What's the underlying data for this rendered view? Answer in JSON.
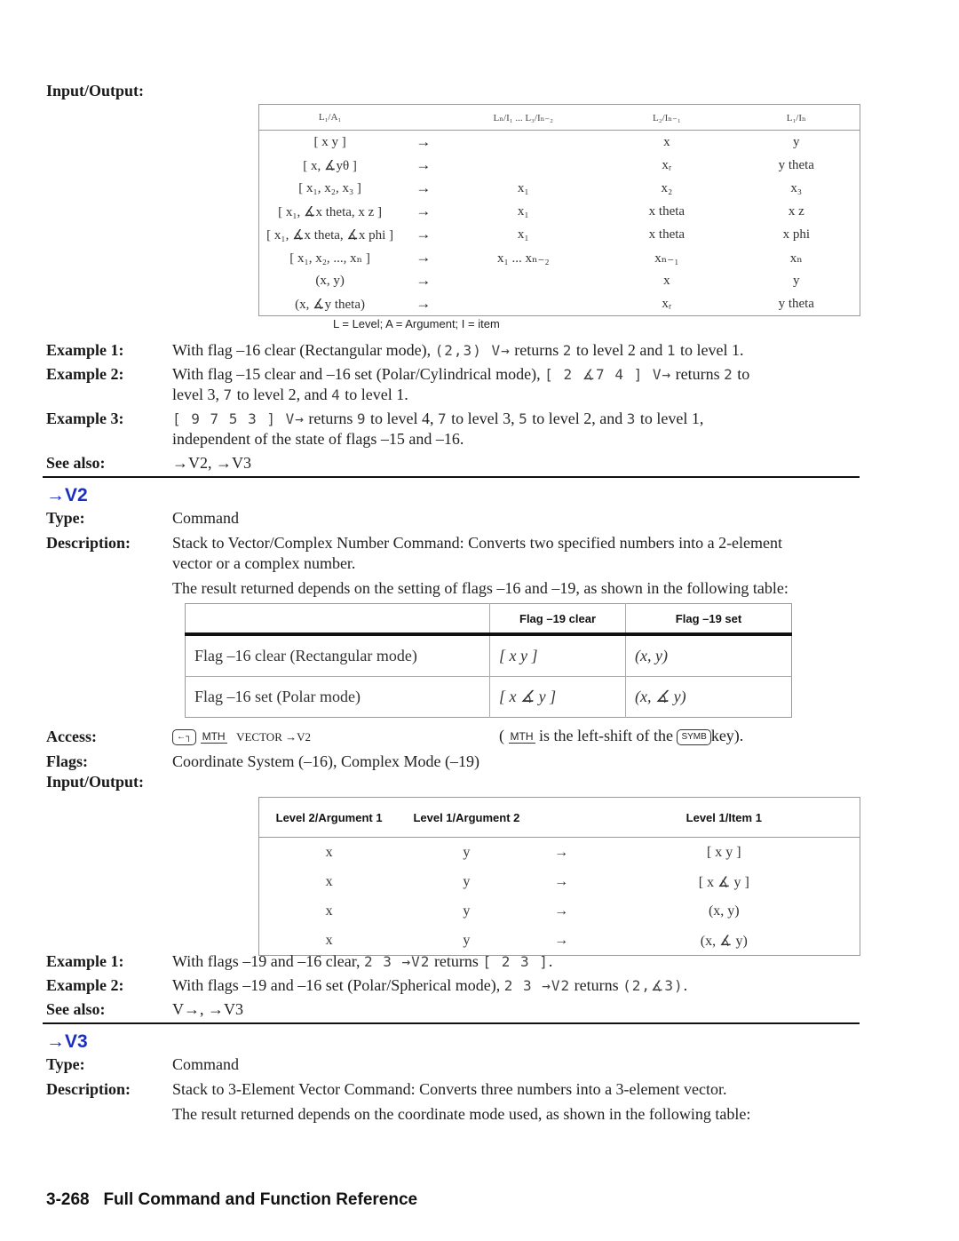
{
  "top_section": {
    "io_label": "Input/Output:",
    "table": {
      "headers": [
        "L₁/A₁",
        "",
        "Lₙ/I₁ ... L₃/Iₙ₋₂",
        "L₂/Iₙ₋₁",
        "L₁/Iₙ"
      ],
      "rows": [
        {
          "input": "[ x y ]",
          "arrow": "→",
          "c1": "",
          "c2": "x",
          "c3": "y"
        },
        {
          "input": "[ x, ∡yθ ]",
          "arrow": "→",
          "c1": "",
          "c2": "xᵣ",
          "c3": "y theta"
        },
        {
          "input": "[ x₁, x₂, x₃ ]",
          "arrow": "→",
          "c1": "x₁",
          "c2": "x₂",
          "c3": "x₃"
        },
        {
          "input": "[ x₁, ∡x theta, x z ]",
          "arrow": "→",
          "c1": "x₁",
          "c2": "x theta",
          "c3": "x z"
        },
        {
          "input": "[ x₁, ∡x theta, ∡x phi ]",
          "arrow": "→",
          "c1": "x₁",
          "c2": "x theta",
          "c3": "x phi"
        },
        {
          "input": "[ x₁, x₂, ..., xₙ ]",
          "arrow": "→",
          "c1": "x₁ ... xₙ₋₂",
          "c2": "xₙ₋₁",
          "c3": "xₙ"
        },
        {
          "input": "(x, y)",
          "arrow": "→",
          "c1": "",
          "c2": "x",
          "c3": "y"
        },
        {
          "input": "(x, ∡y theta)",
          "arrow": "→",
          "c1": "",
          "c2": "xᵣ",
          "c3": "y theta"
        }
      ],
      "note": "L = Level; A = Argument; I = item"
    },
    "examples": [
      {
        "label": "Example 1:",
        "parts": [
          "With flag –16 clear (Rectangular mode), ",
          "(2,3) V→",
          " returns ",
          "2",
          " to level 2 and ",
          "1",
          " to level 1."
        ]
      },
      {
        "label": "Example 2:",
        "line1": [
          "With flag –15 clear and –16 set (Polar/Cylindrical mode), ",
          "[ 2 ∡7 4 ] V→",
          " returns ",
          "2",
          " to"
        ],
        "line2": [
          "level 3, ",
          "7",
          " to level 2, and ",
          "4",
          " to level 1."
        ]
      },
      {
        "label": "Example 3:",
        "line1": [
          "[ 9 7 5 3 ] V→",
          " returns ",
          "9",
          " to level 4, ",
          "7",
          " to level 3, ",
          "5",
          " to level 2, and ",
          "3",
          " to level 1,"
        ],
        "line2": "independent of the state of flags –15 and –16."
      }
    ],
    "see_also_label": "See also:",
    "see_also": "→V2, →V3"
  },
  "v2": {
    "heading": "→V2",
    "type_label": "Type:",
    "type": "Command",
    "description_label": "Description:",
    "description_line1": "Stack to Vector/Complex Number Command: Converts two specified numbers into a 2-element",
    "description_line2": "vector or a complex number.",
    "description_line3": "The result returned depends on the setting of flags –16 and –19, as shown in the following table:",
    "flag_table": {
      "headers": [
        "",
        "Flag –19 clear",
        "Flag –19 set"
      ],
      "rows": [
        [
          "Flag –16 clear (Rectangular mode)",
          "[ x y ]",
          "(x, y)"
        ],
        [
          "Flag –16 set (Polar mode)",
          "[ x ∡ y ]",
          "(x, ∡ y)"
        ]
      ]
    },
    "access_label": "Access:",
    "access_key": "←┐",
    "access_menu": "MTH",
    "access_path": "VECTOR →V2",
    "access_note_open": "(",
    "access_note_menu": "MTH",
    "access_note_mid": "is the left-shift of the",
    "access_note_key": "SYMB",
    "access_note_end": "key).",
    "flags_label": "Flags:",
    "flags": "Coordinate System (–16), Complex Mode (–19)",
    "io_label": "Input/Output:",
    "io_table": {
      "headers": [
        "Level 2/Argument 1",
        "Level 1/Argument 2",
        "",
        "Level 1/Item 1"
      ],
      "rows": [
        [
          "x",
          "y",
          "→",
          "[ x y ]"
        ],
        [
          "x",
          "y",
          "→",
          "[ x ∡ y ]"
        ],
        [
          "x",
          "y",
          "→",
          "(x, y)"
        ],
        [
          "x",
          "y",
          "→",
          "(x, ∡ y)"
        ]
      ]
    },
    "examples": [
      {
        "label": "Example 1:",
        "parts": [
          "With flags –19 and –16 clear, ",
          "2 3 →V2",
          " returns ",
          "[ 2 3 ]",
          "."
        ]
      },
      {
        "label": "Example 2:",
        "parts": [
          "With flags –19 and –16 set (Polar/Spherical mode), ",
          "2 3 →V2",
          " returns ",
          "(2,∡3)",
          "."
        ]
      }
    ],
    "see_also_label": "See also:",
    "see_also": "V→, →V3"
  },
  "v3": {
    "heading": "→V3",
    "type_label": "Type:",
    "type": "Command",
    "description_label": "Description:",
    "description_line1": "Stack to 3-Element Vector Command: Converts three numbers into a 3-element vector.",
    "description_line2": "The result returned depends on the coordinate mode used, as shown in the following table:"
  },
  "footer": {
    "page": "3-268",
    "title": "Full Command and Function Reference"
  }
}
